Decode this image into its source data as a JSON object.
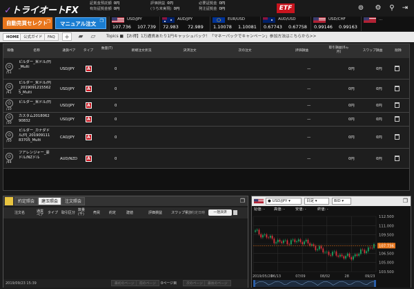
{
  "header": {
    "logo_text": "トライオートFX",
    "account": [
      {
        "label": "証拠金預託額",
        "value": "0円"
      },
      {
        "label": "有効証拠金額",
        "value": "0円"
      },
      {
        "label": "評価損益",
        "value": "0円"
      },
      {
        "label": "(うち未実現)",
        "value": "0円"
      },
      {
        "label": "必要証拠金",
        "value": "0円"
      },
      {
        "label": "発注証拠金",
        "value": "0円"
      }
    ],
    "etf_label": "ETF"
  },
  "toolbar": {
    "auto_label": "自動売買セレクト",
    "manual_label": "マニュアル注文",
    "rates": [
      {
        "pair": "USD/JPY",
        "bid": "107.736",
        "ask": "107.739",
        "spread": "0.3"
      },
      {
        "pair": "AUD/JPY",
        "bid": "72.983",
        "ask": "72.989",
        "spread": "0.6"
      },
      {
        "pair": "EUR/USD",
        "bid": "1.10078",
        "ask": "1.10081",
        "spread": "0.3"
      },
      {
        "pair": "AUD/USD",
        "bid": "0.67743",
        "ask": "0.67758",
        "spread": "1.5"
      },
      {
        "pair": "USD/CHF",
        "bid": "0.99146",
        "ask": "0.99163",
        "spread": "1.7"
      }
    ]
  },
  "nav": {
    "home": "HOME",
    "guide": "公式ガイド",
    "faq": "FAQ",
    "ticker": "Topics ■ 【お得】1万通貨あたり1円キャッシュバック！「マネーパックでキャンペーン」参加方法はこちらから>>"
  },
  "table": {
    "headers": [
      "稼働",
      "名称",
      "通貨ペア",
      "タイプ",
      "数量(T)",
      "新規注文状況",
      "決済注文",
      "次の注文",
      "評価損益",
      "取引損益(6ヵ月)",
      "スワップ損益",
      "削除"
    ],
    "rows": [
      {
        "id": "/51",
        "name": "ビルダー_米ドル/円_Multi",
        "pair": "USD/JPY",
        "qty": "0",
        "pl": "—",
        "trade": "0円",
        "swap": "0円"
      },
      {
        "id": "/41",
        "name": "ビルダー_米ドル/円_20190912155625_Multi",
        "pair": "USD/JPY",
        "qty": "0",
        "pl": "—",
        "trade": "0円",
        "swap": "0円"
      },
      {
        "id": "/10",
        "name": "ビルダー_米ドル/円",
        "pair": "USD/JPY",
        "qty": "0",
        "pl": "—",
        "trade": "0円",
        "swap": "0円"
      },
      {
        "id": "/30",
        "name": "カスタム201806290832",
        "pair": "USD/JPY",
        "qty": "0",
        "pl": "—",
        "trade": "0円",
        "swap": "0円"
      },
      {
        "id": "/50",
        "name": "ビルダー_カナダドル/円_20190911183705_Multi",
        "pair": "CAD/JPY",
        "qty": "0",
        "pl": "—",
        "trade": "0円",
        "swap": "0円"
      },
      {
        "id": "/44",
        "name": "フアレンジャー_豪ドル/NZドル",
        "pair": "AUD/NZD",
        "qty": "0",
        "pl": "—",
        "trade": "0円",
        "swap": "0円"
      }
    ],
    "type_badge": "A"
  },
  "bottom": {
    "tabs": [
      "約定照会",
      "建玉照会",
      "注文照会"
    ],
    "headers": [
      "注文名",
      "通貨ペア",
      "タイプ",
      "取引区分",
      "数量(千)",
      "売買",
      "約定",
      "建値",
      "評価損益",
      "スワップ累計",
      "約定日時"
    ],
    "all_settle": "一括決済",
    "footer_date": "2019/09/23 15:39",
    "prev": "前のページ",
    "first": "最初のページ",
    "next": "次のページ",
    "last": "最後のページ",
    "page": "0ページ目"
  },
  "chart": {
    "pair": "USD/JPY",
    "period": "日足",
    "side": "BID",
    "ohlc": [
      "始値: -",
      "高値: -",
      "安値: -",
      "終値: -"
    ],
    "price_labels": [
      "112.500",
      "111.000",
      "109.500",
      "108.000",
      "106.500",
      "105.000",
      "103.500"
    ],
    "current": "107.736",
    "date_labels": [
      "2019/05/20",
      "06/13",
      "07/09",
      "08/02",
      "28",
      "09/23"
    ],
    "colors": {
      "up": "#1aa260",
      "down": "#d9323c",
      "current": "#e8761c"
    }
  },
  "chart_data": {
    "type": "line",
    "x": [
      "2019/05/20",
      "06/13",
      "07/09",
      "08/02",
      "28",
      "09/23"
    ],
    "series": [
      {
        "values": [
          110.0,
          108.3,
          108.5,
          106.6,
          105.8,
          107.7
        ]
      }
    ],
    "ylim": [
      103.5,
      112.5
    ]
  }
}
